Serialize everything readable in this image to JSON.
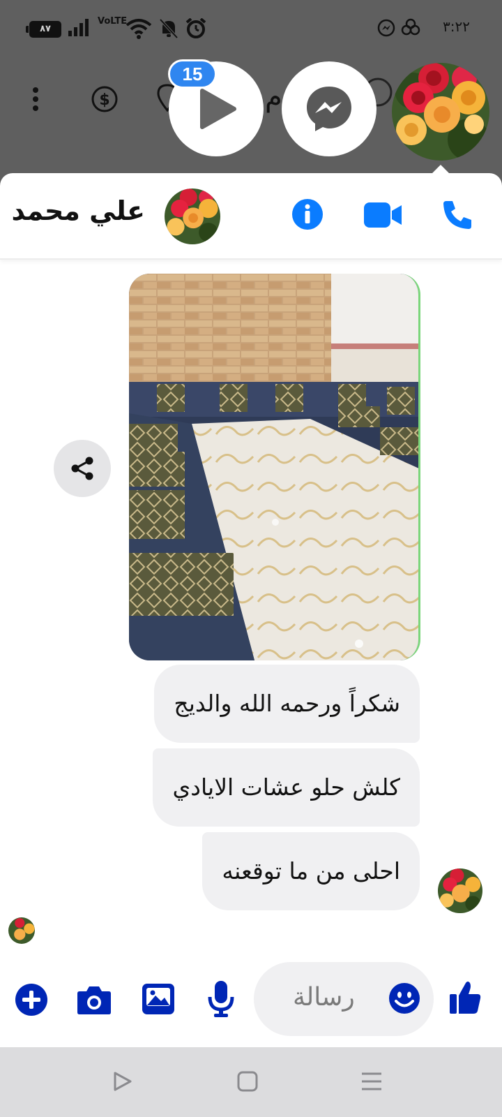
{
  "status_bar": {
    "battery": "٨٧",
    "network": "VoLTE",
    "time": "٣:٢٢"
  },
  "chat_heads": {
    "unread_count": "15",
    "icons": [
      "play-icon",
      "messenger-icon",
      "avatar-roses"
    ]
  },
  "header": {
    "contact_name": "علي محمد",
    "icons": [
      "info-icon",
      "video-call-icon",
      "phone-call-icon"
    ]
  },
  "messages": [
    {
      "text": "شكراً ورحمه الله والديج"
    },
    {
      "text": "كلش حلو عشات الايادي"
    },
    {
      "text": "احلى من ما توقعنه"
    }
  ],
  "composer": {
    "placeholder": "رسالة",
    "icons": [
      "add-icon",
      "camera-icon",
      "gallery-icon",
      "microphone-icon",
      "emoji-icon",
      "like-icon"
    ]
  },
  "colors": {
    "accent": "#0a7cff",
    "composer_icon": "#0026b5",
    "bubble": "#f0f0f2"
  }
}
